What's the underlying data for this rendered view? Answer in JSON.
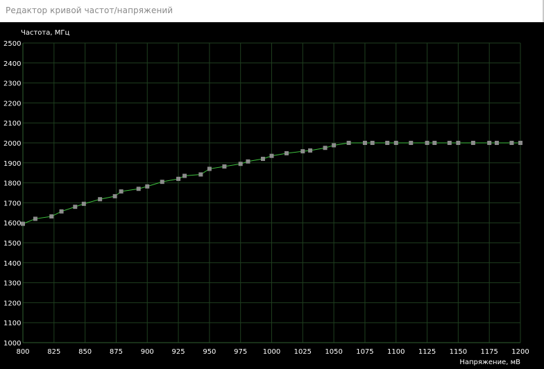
{
  "window": {
    "title": "Редактор кривой частот/напряжений"
  },
  "colors": {
    "background": "#000000",
    "grid": "#1f3f1f",
    "axis": "#2f5f2f",
    "curve": "#3ec13e",
    "point": "#8c8c8c",
    "text": "#ffffff"
  },
  "chart_data": {
    "type": "line",
    "xlabel": "Напряжение, мВ",
    "ylabel": "Частота, МГц",
    "xlim": [
      800,
      1200
    ],
    "ylim": [
      1000,
      2500
    ],
    "xticks": [
      800,
      825,
      850,
      875,
      900,
      925,
      950,
      975,
      1000,
      1025,
      1050,
      1075,
      1100,
      1125,
      1150,
      1175,
      1200
    ],
    "yticks": [
      1000,
      1100,
      1200,
      1300,
      1400,
      1500,
      1600,
      1700,
      1800,
      1900,
      2000,
      2100,
      2200,
      2300,
      2400,
      2500
    ],
    "grid": true,
    "series": [
      {
        "points": [
          [
            800,
            1595
          ],
          [
            810,
            1620
          ],
          [
            823,
            1632
          ],
          [
            831,
            1657
          ],
          [
            842,
            1680
          ],
          [
            849,
            1695
          ],
          [
            862,
            1718
          ],
          [
            874,
            1733
          ],
          [
            879,
            1757
          ],
          [
            893,
            1770
          ],
          [
            900,
            1782
          ],
          [
            912,
            1805
          ],
          [
            925,
            1820
          ],
          [
            930,
            1835
          ],
          [
            943,
            1842
          ],
          [
            950,
            1870
          ],
          [
            962,
            1882
          ],
          [
            975,
            1895
          ],
          [
            981,
            1907
          ],
          [
            993,
            1920
          ],
          [
            1000,
            1935
          ],
          [
            1012,
            1948
          ],
          [
            1025,
            1958
          ],
          [
            1031,
            1962
          ],
          [
            1043,
            1975
          ],
          [
            1050,
            1988
          ],
          [
            1062,
            2000
          ],
          [
            1075,
            2000
          ],
          [
            1081,
            2000
          ],
          [
            1093,
            2000
          ],
          [
            1100,
            2000
          ],
          [
            1112,
            2000
          ],
          [
            1125,
            2000
          ],
          [
            1131,
            2000
          ],
          [
            1143,
            2000
          ],
          [
            1150,
            2000
          ],
          [
            1162,
            2000
          ],
          [
            1175,
            2000
          ],
          [
            1181,
            2000
          ],
          [
            1193,
            2000
          ],
          [
            1200,
            2000
          ]
        ]
      }
    ]
  }
}
